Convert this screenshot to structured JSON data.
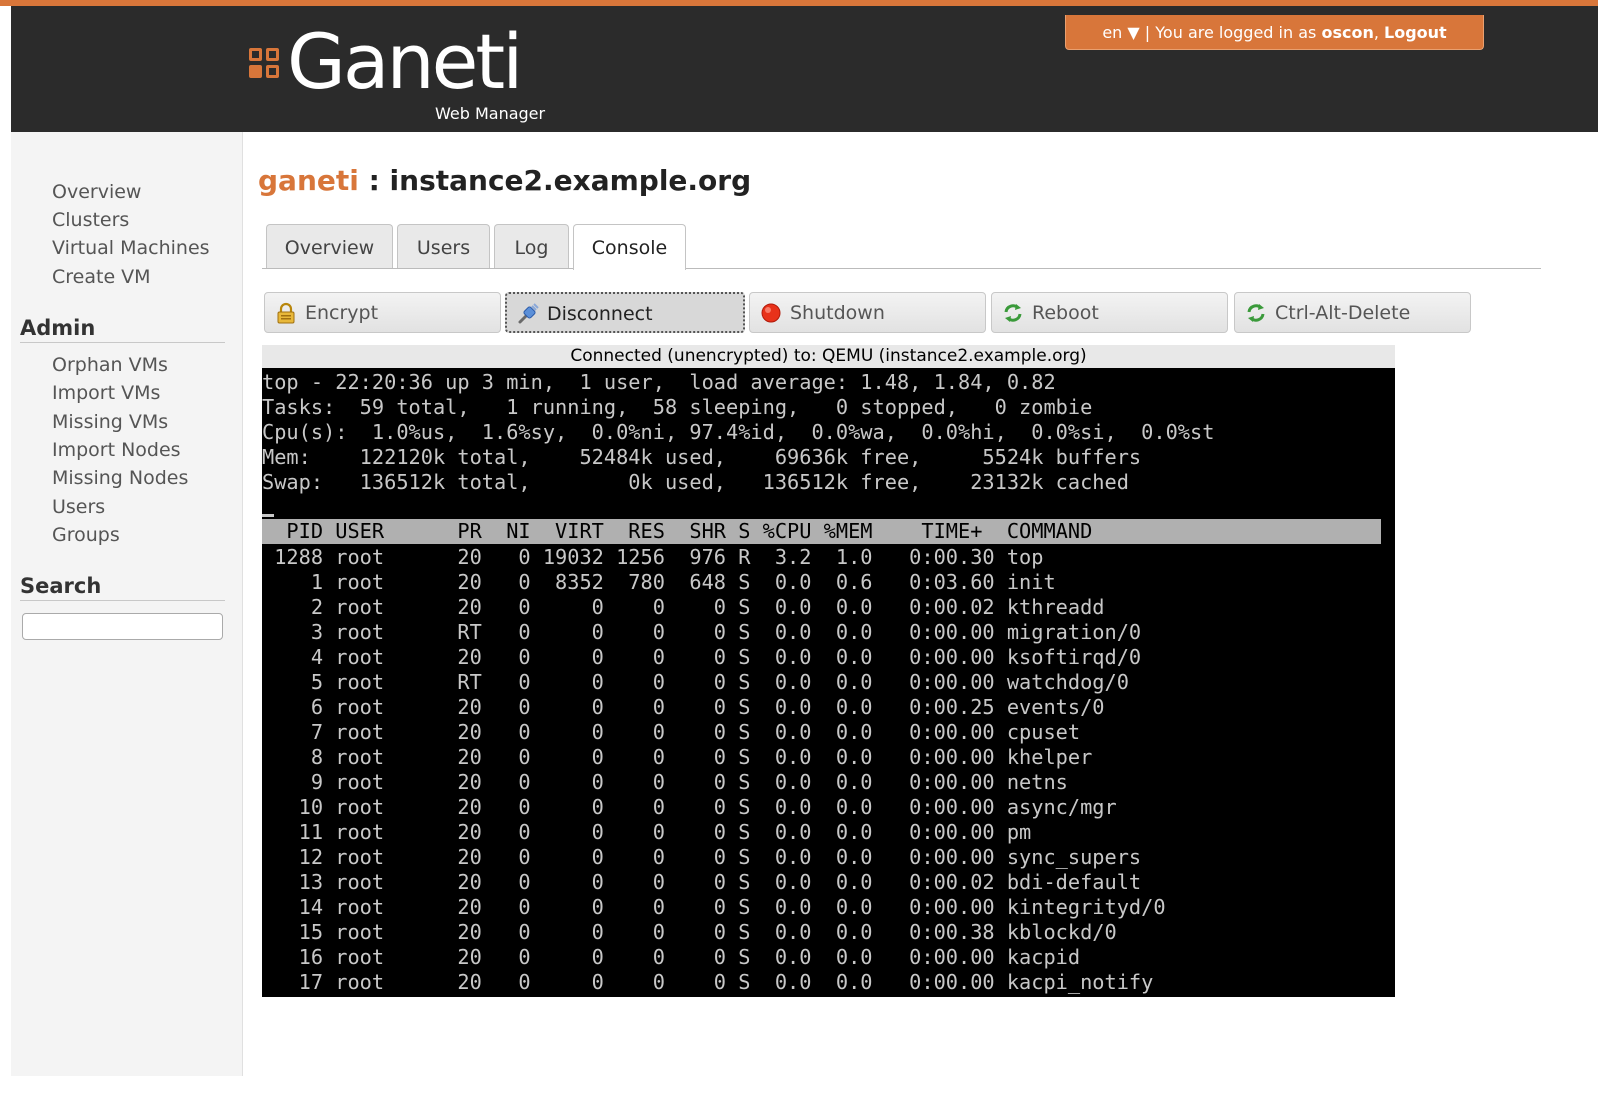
{
  "header": {
    "logo_text": "Ganeti",
    "logo_subtitle": "Web Manager",
    "language": "en",
    "language_arrow": "▼",
    "separator": "|",
    "logged_in_text": "You are logged in as",
    "username": "oscon",
    "logout_label": "Logout"
  },
  "sidebar": {
    "nav": [
      "Overview",
      "Clusters",
      "Virtual Machines",
      "Create VM"
    ],
    "admin_heading": "Admin",
    "admin_items": [
      "Orphan VMs",
      "Import VMs",
      "Missing VMs",
      "Import Nodes",
      "Missing Nodes",
      "Users",
      "Groups"
    ],
    "search_heading": "Search",
    "search_value": ""
  },
  "title": {
    "cluster": "ganeti",
    "separator": " : ",
    "instance": "instance2.example.org"
  },
  "tabs": [
    "Overview",
    "Users",
    "Log",
    "Console"
  ],
  "active_tab": "Console",
  "console_buttons": [
    "Encrypt",
    "Disconnect",
    "Shutdown",
    "Reboot",
    "Ctrl-Alt-Delete"
  ],
  "console": {
    "status": "Connected (unencrypted) to: QEMU (instance2.example.org)",
    "summary": [
      "top - 22:20:36 up 3 min,  1 user,  load average: 1.48, 1.84, 0.82",
      "Tasks:  59 total,   1 running,  58 sleeping,   0 stopped,   0 zombie",
      "Cpu(s):  1.0%us,  1.6%sy,  0.0%ni, 97.4%id,  0.0%wa,  0.0%hi,  0.0%si,  0.0%st",
      "Mem:    122120k total,    52484k used,    69636k free,     5524k buffers",
      "Swap:   136512k total,        0k used,   136512k free,    23132k cached"
    ],
    "header": "  PID USER      PR  NI  VIRT  RES  SHR S %CPU %MEM    TIME+  COMMAND",
    "processes": [
      " 1288 root      20   0 19032 1256  976 R  3.2  1.0   0:00.30 top",
      "    1 root      20   0  8352  780  648 S  0.0  0.6   0:03.60 init",
      "    2 root      20   0     0    0    0 S  0.0  0.0   0:00.02 kthreadd",
      "    3 root      RT   0     0    0    0 S  0.0  0.0   0:00.00 migration/0",
      "    4 root      20   0     0    0    0 S  0.0  0.0   0:00.00 ksoftirqd/0",
      "    5 root      RT   0     0    0    0 S  0.0  0.0   0:00.00 watchdog/0",
      "    6 root      20   0     0    0    0 S  0.0  0.0   0:00.25 events/0",
      "    7 root      20   0     0    0    0 S  0.0  0.0   0:00.00 cpuset",
      "    8 root      20   0     0    0    0 S  0.0  0.0   0:00.00 khelper",
      "    9 root      20   0     0    0    0 S  0.0  0.0   0:00.00 netns",
      "   10 root      20   0     0    0    0 S  0.0  0.0   0:00.00 async/mgr",
      "   11 root      20   0     0    0    0 S  0.0  0.0   0:00.00 pm",
      "   12 root      20   0     0    0    0 S  0.0  0.0   0:00.00 sync_supers",
      "   13 root      20   0     0    0    0 S  0.0  0.0   0:00.02 bdi-default",
      "   14 root      20   0     0    0    0 S  0.0  0.0   0:00.00 kintegrityd/0",
      "   15 root      20   0     0    0    0 S  0.0  0.0   0:00.38 kblockd/0",
      "   16 root      20   0     0    0    0 S  0.0  0.0   0:00.00 kacpid",
      "   17 root      20   0     0    0    0 S  0.0  0.0   0:00.00 kacpi_notify"
    ]
  },
  "colors": {
    "accent": "#d8763a",
    "header_bg": "#2b2b2b",
    "terminal_bg": "#000000",
    "terminal_text": "#c8c8c8"
  }
}
